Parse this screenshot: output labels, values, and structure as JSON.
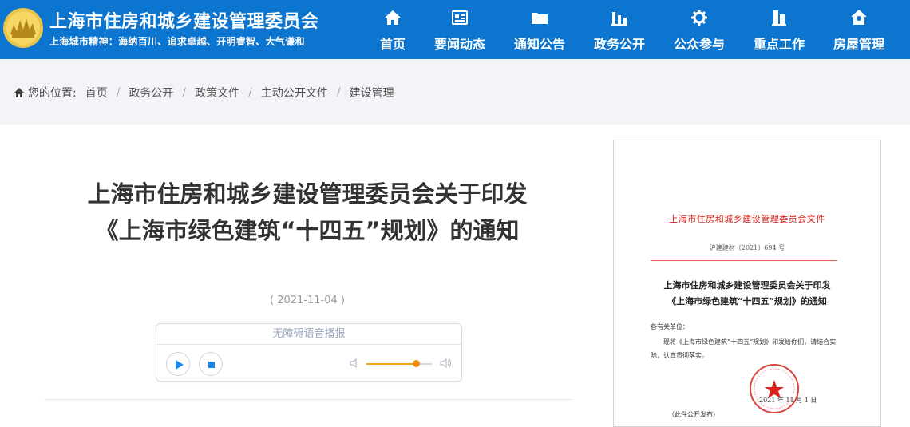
{
  "header": {
    "site_title": "上海市住房和城乡建设管理委员会",
    "motto": "上海城市精神：海纳百川、追求卓越、开明睿智、大气谦和",
    "nav": [
      {
        "label": "首页",
        "icon": "home-icon"
      },
      {
        "label": "要闻动态",
        "icon": "news-icon"
      },
      {
        "label": "通知公告",
        "icon": "folder-icon"
      },
      {
        "label": "政务公开",
        "icon": "bar-chart-icon"
      },
      {
        "label": "公众参与",
        "icon": "gear-icon"
      },
      {
        "label": "重点工作",
        "icon": "building-icon"
      },
      {
        "label": "房屋管理",
        "icon": "house-icon"
      }
    ]
  },
  "breadcrumb": {
    "prefix": "您的位置:",
    "items": [
      "首页",
      "政务公开",
      "政策文件",
      "主动公开文件",
      "建设管理"
    ]
  },
  "article": {
    "title": "上海市住房和城乡建设管理委员会关于印发《上海市绿色建筑“十四五”规划》的通知",
    "date": "( 2021-11-04 )"
  },
  "player": {
    "title": "无障碍语音播报",
    "volume": 0.75,
    "accent_color": "#f08a0c"
  },
  "document": {
    "issuer": "上海市住房和城乡建设管理委员会文件",
    "number": "沪建建材〔2021〕694 号",
    "title_line1": "上海市住房和城乡建设管理委员会关于印发",
    "title_line2": "《上海市绿色建筑“十四五”规划》的通知",
    "greeting": "各有关单位：",
    "body": "现将《上海市绿色建筑“十四五”规划》印发给你们，请结合实际，认真贯彻落实。",
    "date": "2021 年 11 月 1 日",
    "footnote": "（此件公开发布）"
  },
  "colors": {
    "brand": "#0b75cf",
    "crumb_bg": "#f2f4f7",
    "seal_red": "#d6221a"
  }
}
